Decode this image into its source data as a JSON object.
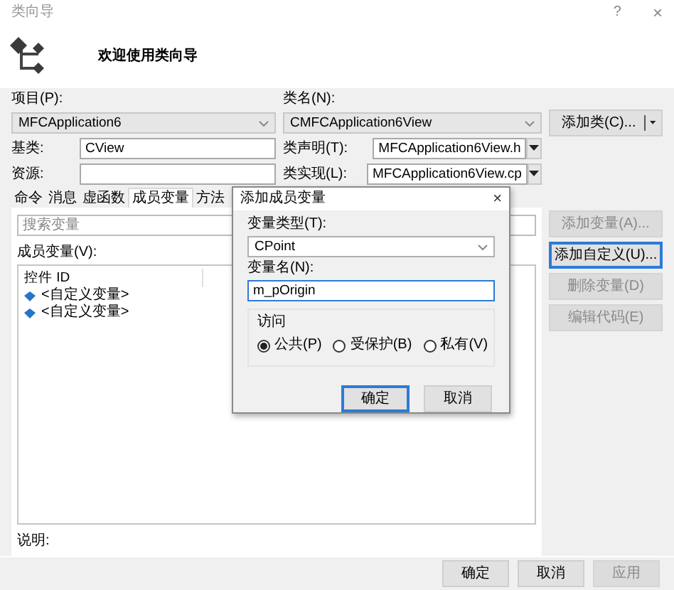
{
  "window": {
    "title": "类向导",
    "help": "?",
    "close": "×"
  },
  "header": {
    "title": "欢迎使用类向导"
  },
  "project": {
    "label": "项目(P):",
    "value": "MFCApplication6"
  },
  "class_name": {
    "label": "类名(N):",
    "value": "CMFCApplication6View"
  },
  "add_class_button": {
    "label": "添加类(C)..."
  },
  "base_class": {
    "label": "基类:",
    "value": "CView"
  },
  "resource": {
    "label": "资源:"
  },
  "class_declaration": {
    "label": "类声明(T):",
    "value": "MFCApplication6View.h"
  },
  "class_implementation": {
    "label": "类实现(L):",
    "value": "MFCApplication6View.cp"
  },
  "tabs": [
    {
      "label": "命令",
      "selected": false
    },
    {
      "label": "消息",
      "selected": false
    },
    {
      "label": "虚函数",
      "selected": false
    },
    {
      "label": "成员变量",
      "selected": true
    },
    {
      "label": "方法",
      "selected": false
    }
  ],
  "search": {
    "placeholder": "搜索变量"
  },
  "member_variables": {
    "label": "成员变量(V):",
    "columns": [
      "控件 ID"
    ],
    "rows": [
      {
        "name": "<自定义变量>"
      },
      {
        "name": "<自定义变量>"
      }
    ]
  },
  "side_buttons": [
    {
      "label": "添加变量(A)...",
      "disabled": true,
      "focused": false
    },
    {
      "label": "添加自定义(U)...",
      "disabled": false,
      "focused": true
    },
    {
      "label": "删除变量(D)",
      "disabled": true,
      "focused": false
    },
    {
      "label": "编辑代码(E)",
      "disabled": true,
      "focused": false
    }
  ],
  "description": {
    "label": "说明:"
  },
  "footer_buttons": [
    {
      "label": "确定",
      "disabled": false
    },
    {
      "label": "取消",
      "disabled": false
    },
    {
      "label": "应用",
      "disabled": true
    }
  ],
  "dialog": {
    "title": "添加成员变量",
    "close": "×",
    "variable_type": {
      "label": "变量类型(T):",
      "value": "CPoint"
    },
    "variable_name": {
      "label": "变量名(N):",
      "value": "m_pOrigin",
      "focused": true
    },
    "access": {
      "label": "访问",
      "options": [
        {
          "label": "公共(P)",
          "selected": true
        },
        {
          "label": "受保护(B)",
          "selected": false
        },
        {
          "label": "私有(V)",
          "selected": false
        }
      ]
    },
    "buttons": [
      {
        "label": "确定",
        "focused": true
      },
      {
        "label": "取消",
        "focused": false
      }
    ]
  }
}
